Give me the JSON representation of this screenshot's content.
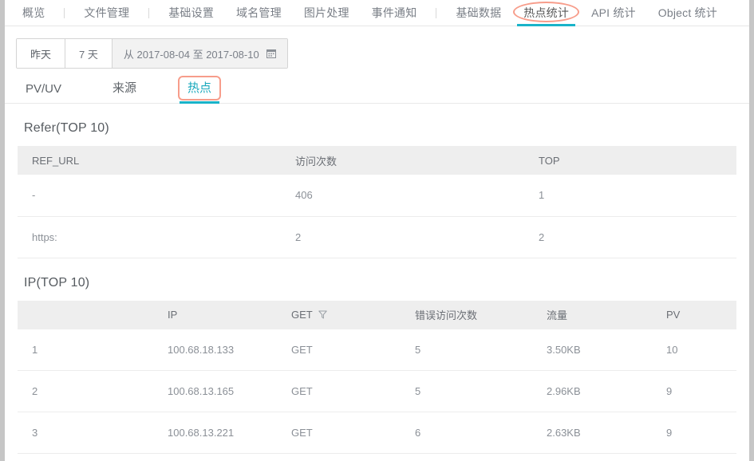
{
  "topnav": {
    "items": [
      {
        "label": "概览",
        "active": false,
        "sep_after": true
      },
      {
        "label": "文件管理",
        "active": false,
        "sep_after": true
      },
      {
        "label": "基础设置",
        "active": false,
        "sep_after": false
      },
      {
        "label": "域名管理",
        "active": false,
        "sep_after": false
      },
      {
        "label": "图片处理",
        "active": false,
        "sep_after": false
      },
      {
        "label": "事件通知",
        "active": false,
        "sep_after": true
      },
      {
        "label": "基础数据",
        "active": false,
        "sep_after": false
      },
      {
        "label": "热点统计",
        "active": true,
        "sep_after": false
      },
      {
        "label": "API 统计",
        "active": false,
        "sep_after": false
      },
      {
        "label": "Object 统计",
        "active": false,
        "sep_after": false
      }
    ],
    "active_index": 7
  },
  "toolbar": {
    "yesterday_label": "昨天",
    "seven_days_label": "7 天",
    "range_label": "从 2017-08-04 至 2017-08-10",
    "calendar_icon": "calendar-icon"
  },
  "subtabs": {
    "items": [
      {
        "label": "PV/UV",
        "active": false
      },
      {
        "label": "来源",
        "active": false
      },
      {
        "label": "热点",
        "active": true
      }
    ],
    "active_index": 2
  },
  "refer_section": {
    "title": "Refer(TOP 10)",
    "columns": [
      "REF_URL",
      "访问次数",
      "TOP"
    ],
    "rows": [
      {
        "ref_url": "-",
        "visits": "406",
        "top": "1"
      },
      {
        "ref_url": "https:",
        "visits": "2",
        "top": "2"
      }
    ]
  },
  "ip_section": {
    "title": "IP(TOP 10)",
    "columns": [
      "",
      "IP",
      "GET",
      "错误访问次数",
      "流量",
      "PV"
    ],
    "filter_icon_column": "GET",
    "filter_icon": "filter-funnel-icon",
    "rows": [
      {
        "index": "1",
        "ip": "100.68.18.133",
        "method": "GET",
        "errors": "5",
        "traffic": "3.50KB",
        "pv": "10"
      },
      {
        "index": "2",
        "ip": "100.68.13.165",
        "method": "GET",
        "errors": "5",
        "traffic": "2.96KB",
        "pv": "9"
      },
      {
        "index": "3",
        "ip": "100.68.13.221",
        "method": "GET",
        "errors": "6",
        "traffic": "2.63KB",
        "pv": "9"
      }
    ]
  },
  "colors": {
    "accent_cyan": "#19b3c9",
    "annotation_salmon": "#f79d8b",
    "header_gray": "#eeeeee",
    "text_gray": "#8b9097",
    "gutter_gray": "#c6c6c6"
  }
}
